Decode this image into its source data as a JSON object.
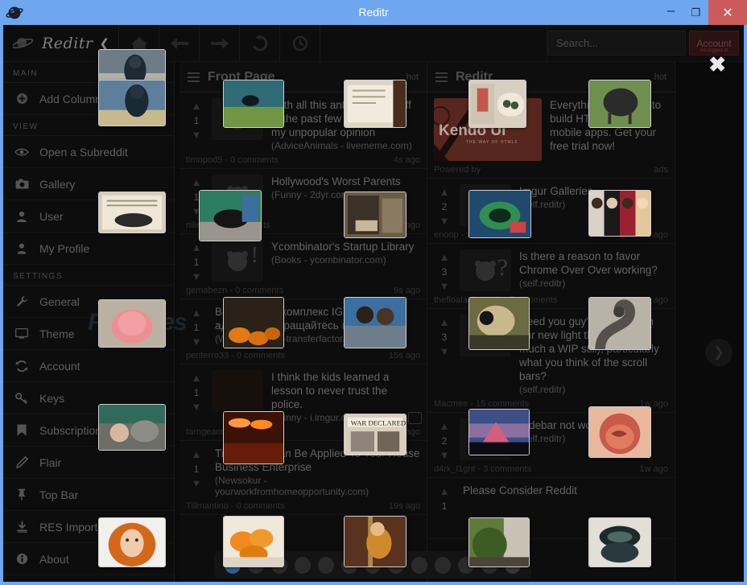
{
  "window": {
    "title": "Reditr",
    "icon": "reditr-planet-icon",
    "minimize": "–",
    "maximize": "❐",
    "close": "✕",
    "title_bar_color": "#6ea7ee",
    "close_button_color": "#cb5a5a"
  },
  "toolbar": {
    "brand": "Reditr",
    "brand_caret": "❮",
    "buttons": [
      {
        "name": "home-icon",
        "label": "Home"
      },
      {
        "name": "back-arrow-icon",
        "label": "Back"
      },
      {
        "name": "forward-arrow-icon",
        "label": "Forward"
      },
      {
        "name": "refresh-icon",
        "label": "Refresh"
      },
      {
        "name": "history-clock-icon",
        "label": "History"
      }
    ],
    "search": {
      "placeholder": "Search...",
      "value": "",
      "icon": "search-icon"
    },
    "account_button": "Account",
    "account_sub": "not logged in",
    "close_overlay": "✖"
  },
  "sidebar": {
    "groups": [
      {
        "label": "MAIN",
        "items": [
          {
            "label": "Add Column",
            "icon": "plus-circle-icon"
          }
        ]
      },
      {
        "label": "VIEW",
        "items": [
          {
            "label": "Open a Subreddit",
            "icon": "eye-icon"
          },
          {
            "label": "Gallery",
            "icon": "camera-icon"
          },
          {
            "label": "User",
            "icon": "user-icon"
          },
          {
            "label": "My Profile",
            "icon": "profile-icon"
          }
        ]
      },
      {
        "label": "SETTINGS",
        "items": [
          {
            "label": "General",
            "icon": "wrench-icon"
          },
          {
            "label": "Theme",
            "icon": "monitor-icon"
          },
          {
            "label": "Account",
            "icon": "sync-icon"
          },
          {
            "label": "Keys",
            "icon": "key-icon"
          },
          {
            "label": "Subscriptions",
            "icon": "bookmark-icon"
          },
          {
            "label": "Flair",
            "icon": "pencil-icon"
          },
          {
            "label": "Top Bar",
            "icon": "pin-icon"
          },
          {
            "label": "RES Import",
            "icon": "download-icon"
          },
          {
            "label": "About",
            "icon": "info-icon"
          }
        ]
      }
    ]
  },
  "columns": [
    {
      "title": "Front Page",
      "sort": "hot",
      "menu_icon": "hamburger-icon",
      "posts": [
        {
          "score": "1",
          "title": "With all this anti-bullying stuff in the past few years, this is my unpopular opinion",
          "meta": "(AdviceAnimals - livememe.com)",
          "author": "timopod5",
          "comments": "0 comments",
          "age": "4s ago",
          "thumb": "snoo-exclamation"
        },
        {
          "score": "1",
          "title": "Hollywood's Worst Parents",
          "meta": "(Funny - 2dyr.com)",
          "author": "nilingyr",
          "comments": "0 comments",
          "age": "6s ago",
          "thumb": "snoo"
        },
        {
          "score": "1",
          "title": "Ycombinator's Startup Library",
          "meta": "(Books - ycombinator.com)",
          "author": "gemabezn",
          "comments": "0 comments",
          "age": "9s ago",
          "thumb": "snoo-exclamation"
        },
        {
          "score": "1",
          "title": "Витаминный комплекс IGF-1 сильный адаптоген Обращайтесь поможем",
          "meta": "(Worldnews - ru-transferfactor.ru)",
          "author": "penterro33",
          "comments": "0 comments",
          "age": "15s ago",
          "thumb": "none"
        },
        {
          "score": "1",
          "title": "I think the kids learned a lesson to never trust the police.",
          "meta": "(Funny - i.imgur.com)",
          "author": "tarngeants",
          "comments": "0 comments",
          "age": "17s ago",
          "thumb": "dark-photo"
        },
        {
          "score": "1",
          "title": "Tips Which Can Be Applied To Your House Business Enterprise",
          "meta": "(Newsokur - yourworkfromhomeopportunity.com)",
          "author": "Tillmantino",
          "comments": "0 comments",
          "age": "19s ago",
          "thumb": "none"
        }
      ]
    },
    {
      "title": "Reditr",
      "sort": "hot",
      "menu_icon": "hamburger-icon",
      "posts": [
        {
          "is_ad": true,
          "title": "Everything you need to build HTML5 sites & mobile apps. Get your free trial now!",
          "ad_brand": "Kendo UI",
          "ad_brand_sub": "THE WAY OF HTML5",
          "author": "Powered by",
          "comments": "",
          "age": "ads"
        },
        {
          "score": "2",
          "title": "Imgur Galleries",
          "meta": "(self.reditr)",
          "author": "enoop",
          "comments": "0 comments",
          "age": "5d ago",
          "thumb": "snoo-question"
        },
        {
          "score": "3",
          "title": "Is there a reason to favor Chrome Over Over working?",
          "meta": "(self.reditr)",
          "author": "thefloatablemonk",
          "comments": "7 comments",
          "age": "1w ago",
          "thumb": "snoo-question"
        },
        {
          "score": "3",
          "title": "Need you guy's thoughts on our new light theme (very much a WIP still), particularly what you think of the scroll bars?",
          "meta": "(self.reditr)",
          "author": "Macmee",
          "comments": "15 comments",
          "age": "1w ago",
          "thumb": "snoo-question"
        },
        {
          "score": "2",
          "title": "Sidebar not working",
          "meta": "(self.reditr)",
          "author": "d4rk_l1ght",
          "comments": "3 comments",
          "age": "1w ago",
          "thumb": "snoo-question"
        },
        {
          "score": "1",
          "title": "Please Consider Reddit",
          "meta": "(self.reditr)",
          "author": "",
          "comments": "",
          "age": "",
          "thumb": "none"
        }
      ]
    }
  ],
  "nav_arrow": {
    "label": "❯",
    "name": "next-column-arrow"
  },
  "dock": {
    "count": 13,
    "active_index": 0,
    "last_icon": "settings-dot"
  },
  "watermark": "FreeFiles"
}
